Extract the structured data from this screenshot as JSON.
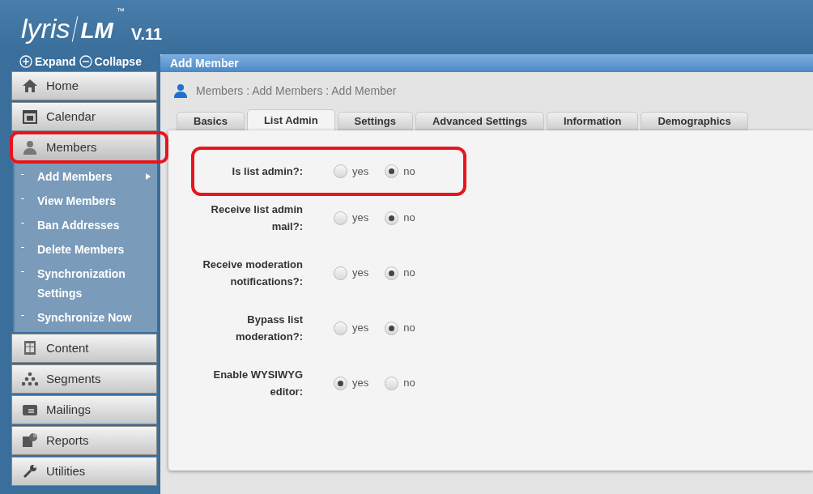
{
  "header": {
    "logo": "lyris",
    "product": "LM",
    "trademark": "™",
    "version": "V.11"
  },
  "sidebar": {
    "expand": "Expand",
    "collapse": "Collapse",
    "items": [
      {
        "label": "Home",
        "selected": false
      },
      {
        "label": "Calendar",
        "selected": false
      },
      {
        "label": "Members",
        "selected": true,
        "children": [
          {
            "label": "Add Members",
            "has_submenu": true
          },
          {
            "label": "View Members",
            "has_submenu": false
          },
          {
            "label": "Ban Addresses",
            "has_submenu": false
          },
          {
            "label": "Delete Members",
            "has_submenu": false
          },
          {
            "label": "Synchronization Settings",
            "has_submenu": false
          },
          {
            "label": "Synchronize Now",
            "has_submenu": false
          }
        ]
      },
      {
        "label": "Content",
        "selected": false
      },
      {
        "label": "Segments",
        "selected": false
      },
      {
        "label": "Mailings",
        "selected": false
      },
      {
        "label": "Reports",
        "selected": false
      },
      {
        "label": "Utilities",
        "selected": false
      }
    ]
  },
  "panel": {
    "title": "Add Member",
    "breadcrumb": "Members : Add Members : Add Member"
  },
  "tabs": [
    {
      "label": "Basics",
      "selected": false
    },
    {
      "label": "List Admin",
      "selected": true
    },
    {
      "label": "Settings",
      "selected": false
    },
    {
      "label": "Advanced Settings",
      "selected": false
    },
    {
      "label": "Information",
      "selected": false
    },
    {
      "label": "Demographics",
      "selected": false
    }
  ],
  "form": [
    {
      "label": "Is list admin?:",
      "highlighted": true,
      "options": [
        {
          "label": "yes",
          "selected": false
        },
        {
          "label": "no",
          "selected": true
        }
      ]
    },
    {
      "label": "Receive list admin mail?:",
      "highlighted": false,
      "options": [
        {
          "label": "yes",
          "selected": false
        },
        {
          "label": "no",
          "selected": true
        }
      ]
    },
    {
      "label": "Receive moderation notifications?:",
      "highlighted": false,
      "options": [
        {
          "label": "yes",
          "selected": false
        },
        {
          "label": "no",
          "selected": true
        }
      ]
    },
    {
      "label": "Bypass list moderation?:",
      "highlighted": false,
      "options": [
        {
          "label": "yes",
          "selected": false
        },
        {
          "label": "no",
          "selected": true
        }
      ]
    },
    {
      "label": "Enable WYSIWYG editor:",
      "highlighted": false,
      "options": [
        {
          "label": "yes",
          "selected": true
        },
        {
          "label": "no",
          "selected": false
        }
      ]
    }
  ]
}
